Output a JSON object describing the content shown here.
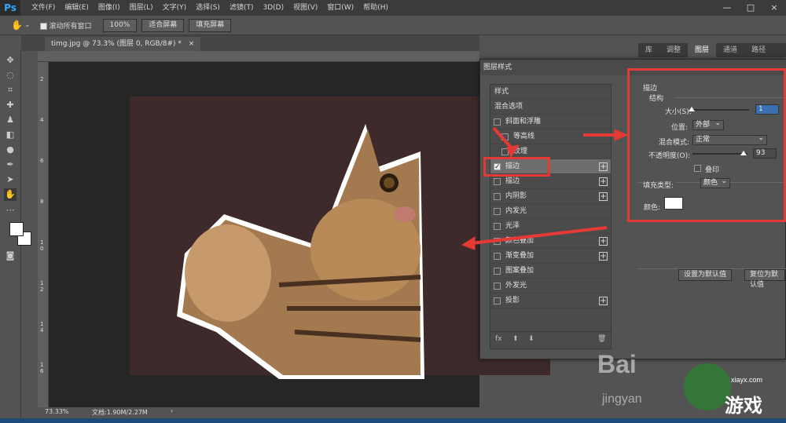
{
  "app": {
    "logo": "Ps",
    "menu": [
      "文件(F)",
      "编辑(E)",
      "图像(I)",
      "图层(L)",
      "文字(Y)",
      "选择(S)",
      "滤镜(T)",
      "3D(D)",
      "视图(V)",
      "窗口(W)",
      "帮助(H)"
    ],
    "window_controls": [
      "—",
      "□",
      "×"
    ]
  },
  "options_bar": {
    "scroll_all_label": "滚动所有窗口",
    "zoom_value": "100%",
    "fit_screen": "适合屏幕",
    "fill_screen": "填充屏幕"
  },
  "document": {
    "tab_title": "timg.jpg @ 73.3% (图层 0, RGB/8#) *",
    "tab_close": "×",
    "zoom": "73.33%",
    "doc_size": "文档:1.90M/2.27M",
    "status_arrow": "›",
    "ruler_v_numbers": [
      "2",
      "4",
      "6",
      "8",
      "1\n0",
      "1\n2",
      "1\n4",
      "1\n6"
    ]
  },
  "panels": {
    "tabs": [
      "库",
      "调整",
      "图层",
      "通道",
      "路径"
    ],
    "active_tab": "图层"
  },
  "dialog": {
    "title": "图层样式",
    "list": [
      {
        "label": "样式",
        "checkbox": false,
        "checked": false,
        "plus": false
      },
      {
        "label": "混合选项",
        "checkbox": false,
        "checked": false,
        "plus": false
      },
      {
        "label": "斜面和浮雕",
        "checkbox": true,
        "checked": false,
        "plus": false
      },
      {
        "label": "等高线",
        "checkbox": true,
        "checked": false,
        "plus": false,
        "indent": true
      },
      {
        "label": "纹理",
        "checkbox": true,
        "checked": false,
        "plus": false,
        "indent": true
      },
      {
        "label": "描边",
        "checkbox": true,
        "checked": true,
        "plus": true,
        "selected": true
      },
      {
        "label": "描边",
        "checkbox": true,
        "checked": false,
        "plus": true
      },
      {
        "label": "内阴影",
        "checkbox": true,
        "checked": false,
        "plus": true
      },
      {
        "label": "内发光",
        "checkbox": true,
        "checked": false,
        "plus": false
      },
      {
        "label": "光泽",
        "checkbox": true,
        "checked": false,
        "plus": false
      },
      {
        "label": "颜色叠加",
        "checkbox": true,
        "checked": false,
        "plus": true
      },
      {
        "label": "渐变叠加",
        "checkbox": true,
        "checked": false,
        "plus": true
      },
      {
        "label": "图案叠加",
        "checkbox": true,
        "checked": false,
        "plus": false
      },
      {
        "label": "外发光",
        "checkbox": true,
        "checked": false,
        "plus": false
      },
      {
        "label": "投影",
        "checkbox": true,
        "checked": false,
        "plus": true
      }
    ],
    "list_footer": {
      "fx": "fx",
      "up": "⬆",
      "down": "⬇",
      "trash": "🗑"
    },
    "stroke": {
      "section_title": "描边",
      "group_title": "结构",
      "size_label": "大小(S):",
      "size_value": 1,
      "size_fraction": 0.02,
      "position_label": "位置:",
      "position_value": "外部",
      "blend_label": "混合模式:",
      "blend_value": "正常",
      "opacity_label": "不透明度(O):",
      "opacity_value": "93",
      "opacity_fraction": 0.93,
      "overprint_label": "叠印",
      "fill_type_label": "填充类型:",
      "fill_type_value": "颜色",
      "color_label": "颜色:",
      "color_value": "#ffffff"
    },
    "buttons": {
      "set_default": "设置为默认值",
      "reset_default": "复位为默认值"
    }
  },
  "watermark": {
    "baidu": "Bai",
    "jingyan": "jingyan",
    "site": "xiayx.com",
    "game": "游戏"
  },
  "colors": {
    "annotation_red": "#e53935",
    "canvas_bg": "#3e2a2a",
    "ps_blue": "#31a8ff"
  }
}
